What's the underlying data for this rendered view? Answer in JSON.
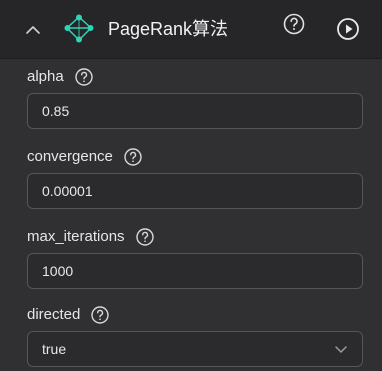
{
  "header": {
    "title": "PageRank算法",
    "collapse_icon": "chevron-up-icon",
    "algo_icon": "graph-nodes-icon",
    "help_icon": "question-circle-icon",
    "run_icon": "play-circle-icon"
  },
  "fields": [
    {
      "label": "alpha",
      "value": "0.85"
    },
    {
      "label": "convergence",
      "value": "0.00001"
    },
    {
      "label": "max_iterations",
      "value": "1000"
    },
    {
      "label": "directed",
      "value": "true"
    }
  ],
  "colors": {
    "header_bg": "#262628",
    "panel_bg": "#303033",
    "border": "#55555a",
    "icon_teal": "#2fd3b5"
  }
}
